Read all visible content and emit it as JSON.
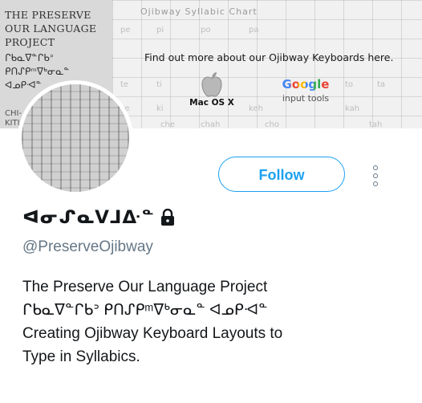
{
  "banner": {
    "brand_title": "The Preserve Our Language Project",
    "brand_syllabics": "ᒋᑲᓇᐁᓐᒋᑲᐣ\nᑭᑎᔑᑭᵐᐁᒃᓂᓇᓐ\nᐊᓄᑭᐗᓐ",
    "brand_footer": "CHI-\nKITIS",
    "chart_title": "Ojibway Syllabic Chart",
    "headline": "Find out more about our Ojibway Keyboards here.",
    "mac_label": "Mac OS X",
    "google_word": "Google",
    "google_sub": "input tools",
    "ghost_letters": [
      "pe",
      "pi",
      "po",
      "pa",
      "te",
      "ti",
      "to",
      "ta",
      "ke",
      "ki",
      "ko",
      "ka",
      "che",
      "chi",
      "cho",
      "chah",
      "keh",
      "koh",
      "kah",
      "tah"
    ]
  },
  "profile": {
    "follow_label": "Follow",
    "display_name": "ᐊᓂᔑᓇᐯᒧᐏᓐ",
    "handle": "@PreserveOjibway",
    "bio_lines": [
      "The Preserve Our Language Project",
      "ᒋᑲᓇᐁᓐᒋᑲᐣ ᑭᑎᔑᑭᵐᐁᒃᓂᓇᓐ ᐊᓄᑭᐗᓐ",
      "Creating Ojibway Keyboard Layouts to",
      "Type in Syllabics."
    ]
  },
  "colors": {
    "accent": "#1da1f2",
    "text_primary": "#14171a",
    "text_secondary": "#657786"
  },
  "icons": {
    "lock": "lock-icon",
    "more": "more-vertical-icon",
    "apple": "apple-logo-icon"
  }
}
